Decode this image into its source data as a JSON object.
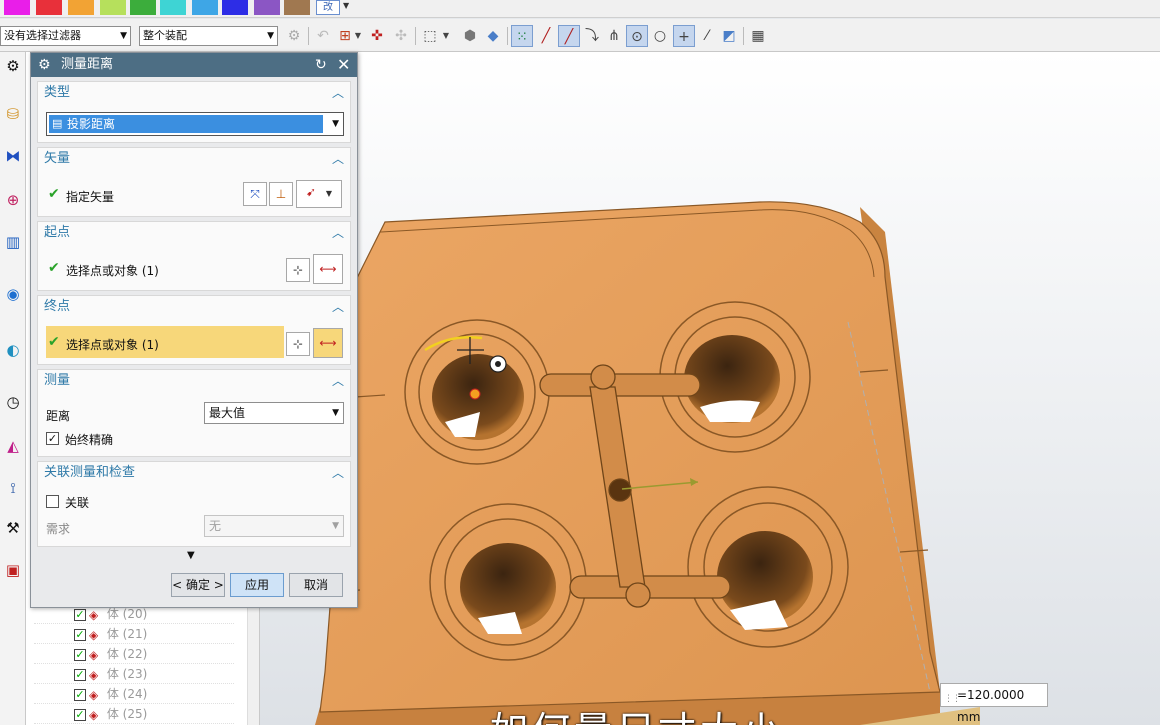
{
  "colorbar": {
    "swatches": [
      "#e91ee9",
      "#e8303a",
      "#f2a334",
      "#b6e05c",
      "#3cad3c",
      "#3ed4d4",
      "#3ea6e6",
      "#2d2de6",
      "#8b56c4",
      "#a07850"
    ],
    "more_label": "改"
  },
  "toolbar": {
    "filter_value": "没有选择过滤器",
    "scope_value": "整个装配"
  },
  "dialog": {
    "title": "测量距离",
    "type_group": {
      "header": "类型",
      "selected": "投影距离"
    },
    "vector_group": {
      "header": "矢量",
      "label": "指定矢量"
    },
    "start_group": {
      "header": "起点",
      "label": "选择点或对象 (1)"
    },
    "end_group": {
      "header": "终点",
      "label": "选择点或对象 (1)"
    },
    "measure_group": {
      "header": "测量",
      "distance_label": "距离",
      "distance_value": "最大值",
      "precise_label": "始终精确",
      "precise_checked": true
    },
    "assoc_group": {
      "header": "关联测量和检查",
      "assoc_label": "关联",
      "assoc_checked": false,
      "req_label": "需求",
      "req_value": "无"
    },
    "buttons": {
      "ok": "< 确定 >",
      "apply": "应用",
      "cancel": "取消"
    }
  },
  "nav_tree": {
    "rows": [
      "体 (20)",
      "体 (21)",
      "体 (22)",
      "体 (23)",
      "体 (24)",
      "体 (25)"
    ]
  },
  "viewport": {
    "part_color": "#e8a35e",
    "measure_readout": "=120.0000 mm",
    "overlay_text": "如何量尺寸大小"
  }
}
